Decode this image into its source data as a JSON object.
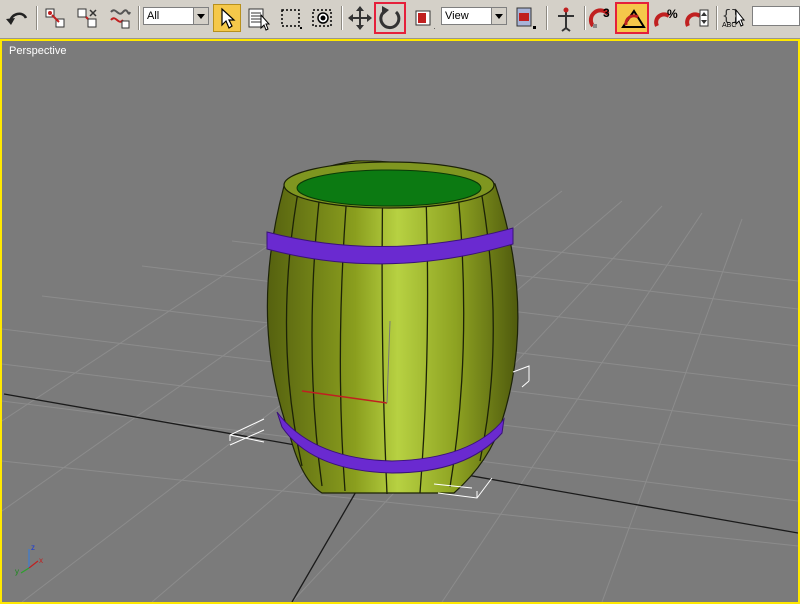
{
  "toolbar": {
    "selection_filter": "All",
    "reference_coord_system": "View",
    "tools": [
      {
        "name": "undo-icon",
        "active": false,
        "highlighted": false
      },
      {
        "name": "select-and-link-icon",
        "active": false,
        "highlighted": false
      },
      {
        "name": "unlink-selection-icon",
        "active": false,
        "highlighted": false
      },
      {
        "name": "bind-to-space-warp-icon",
        "active": false,
        "highlighted": false
      },
      {
        "name": "select-object-icon",
        "active": true,
        "highlighted": false
      },
      {
        "name": "select-by-name-icon",
        "active": false,
        "highlighted": false
      },
      {
        "name": "rectangular-selection-region-icon",
        "active": false,
        "highlighted": false
      },
      {
        "name": "window-crossing-icon",
        "active": false,
        "highlighted": false
      },
      {
        "name": "select-and-move-icon",
        "active": false,
        "highlighted": false
      },
      {
        "name": "select-and-rotate-icon",
        "active": false,
        "highlighted": true
      },
      {
        "name": "select-and-scale-icon",
        "active": false,
        "highlighted": false
      },
      {
        "name": "use-pivot-center-icon",
        "active": false,
        "highlighted": false
      },
      {
        "name": "select-and-manipulate-icon",
        "active": false,
        "highlighted": false
      },
      {
        "name": "snaps-toggle-icon",
        "active": false,
        "highlighted": false
      },
      {
        "name": "angle-snap-toggle-icon",
        "active": true,
        "highlighted": true
      },
      {
        "name": "percent-snap-toggle-icon",
        "active": false,
        "highlighted": false
      },
      {
        "name": "spinner-snap-toggle-icon",
        "active": false,
        "highlighted": false
      },
      {
        "name": "edit-named-selection-sets-icon",
        "active": false,
        "highlighted": false
      }
    ],
    "snap_label": "3",
    "named_selection_abbr": "ABC"
  },
  "viewport": {
    "label": "Perspective",
    "border_color": "#ffe800",
    "background_color": "#7b7b7b",
    "axis_labels": {
      "x": "x",
      "y": "y",
      "z": "z"
    }
  },
  "scene": {
    "object": "barrel",
    "wood_color": "#8aa020",
    "hoop_color": "#6a2ad0",
    "top_fill_color": "#0c7a12"
  }
}
